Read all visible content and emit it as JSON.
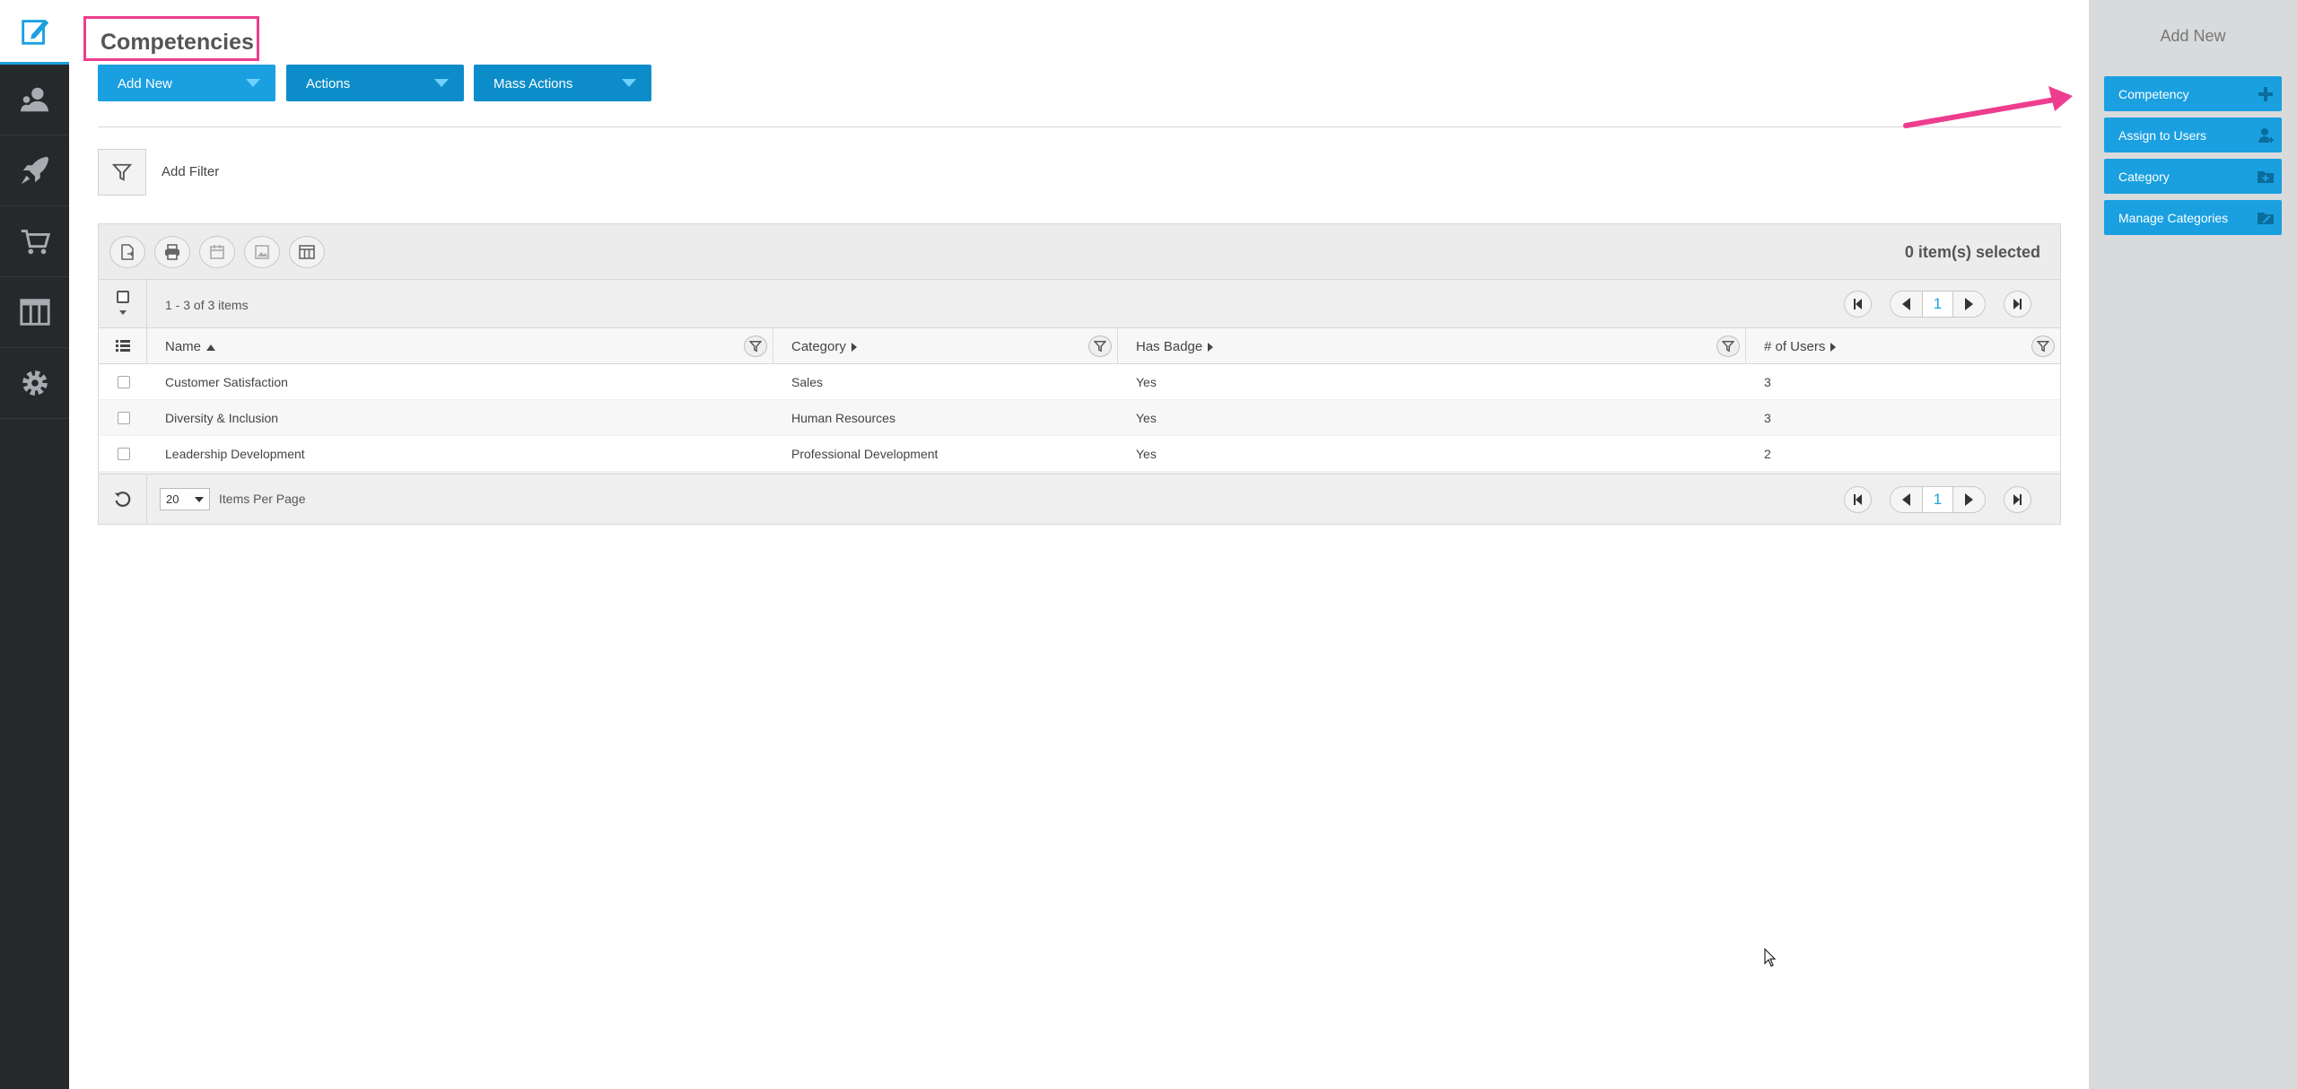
{
  "nav": {
    "items": [
      {
        "icon": "edit-document-icon",
        "active": true
      },
      {
        "icon": "users-icon"
      },
      {
        "icon": "rocket-icon"
      },
      {
        "icon": "cart-icon"
      },
      {
        "icon": "columns-icon"
      },
      {
        "icon": "gear-icon"
      }
    ]
  },
  "page": {
    "title": "Competencies"
  },
  "toolbar": {
    "add_new": "Add New",
    "actions": "Actions",
    "mass_actions": "Mass Actions",
    "add_filter": "Add Filter"
  },
  "grid": {
    "selected_count": "0 item(s) selected",
    "range_text": "1 - 3 of 3 items",
    "current_page": "1",
    "columns": [
      {
        "label": "Name"
      },
      {
        "label": "Category"
      },
      {
        "label": "Has Badge"
      },
      {
        "label": "# of Users"
      }
    ],
    "rows": [
      {
        "name": "Customer Satisfaction",
        "category": "Sales",
        "has_badge": "Yes",
        "users": "3"
      },
      {
        "name": "Diversity & Inclusion",
        "category": "Human Resources",
        "has_badge": "Yes",
        "users": "3"
      },
      {
        "name": "Leadership Development",
        "category": "Professional Development",
        "has_badge": "Yes",
        "users": "2"
      }
    ],
    "per_page_value": "20",
    "per_page_label": "Items Per Page"
  },
  "right_panel": {
    "title": "Add New",
    "buttons": [
      {
        "label": "Competency",
        "icon": "plus-icon"
      },
      {
        "label": "Assign to Users",
        "icon": "user-add-icon"
      },
      {
        "label": "Category",
        "icon": "folder-add-icon"
      },
      {
        "label": "Manage Categories",
        "icon": "folder-edit-icon"
      }
    ]
  },
  "colors": {
    "accent": "#1aa0e0",
    "accent_dark": "#0c8dc9",
    "highlight": "#ee3d8f",
    "nav_bg": "#26292c",
    "panel_bg": "#d8dadb"
  }
}
